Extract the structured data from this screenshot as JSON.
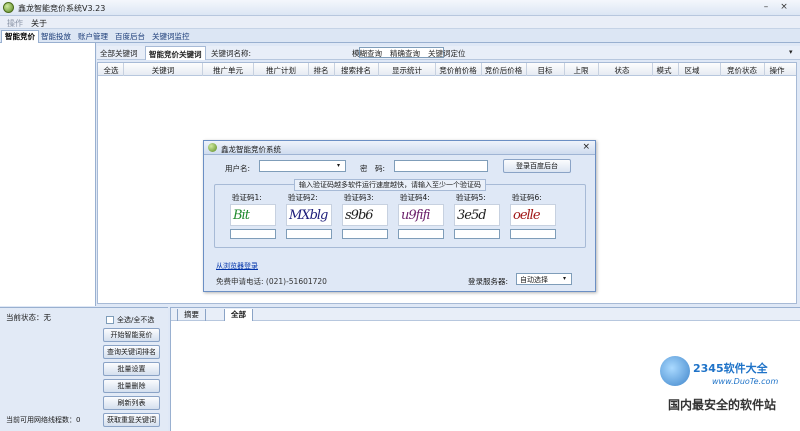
{
  "window": {
    "title": "鑫龙智能竞价系统V3.23",
    "min": "–",
    "close": "×"
  },
  "menu": [
    "操作",
    "关于"
  ],
  "main_tabs": [
    "智能竞价",
    "智能投放",
    "账户管理",
    "百度后台",
    "关键词监控"
  ],
  "sub_toolbar": {
    "tabs": [
      "全部关键词",
      "智能竞价关键词"
    ],
    "kw_label": "关键词名称:",
    "kw_value": "",
    "links": [
      "模糊查询",
      "精确查询",
      "关键词定位"
    ]
  },
  "grid_columns": [
    "全选",
    "关键词",
    "推广单元",
    "推广计划",
    "排名",
    "搜索排名",
    "显示统计",
    "竞价前价格",
    "竞价后价格",
    "目标",
    "上限",
    "状态",
    "模式",
    "区域",
    "竞价状态",
    "操作"
  ],
  "login_dialog": {
    "title": "鑫龙智能竞价系统",
    "close": "×",
    "username_label": "用户名:",
    "username_value": "",
    "password_label": "密　码:",
    "password_value": "",
    "login_button": "登录百度后台",
    "captcha_hint": "输入验证码越多软件运行速度越快，请输入至少一个验证码",
    "captchas": [
      {
        "label": "验证码1:",
        "text": "Bit",
        "color": "#1f8a2e"
      },
      {
        "label": "验证码2:",
        "text": "MXblg",
        "color": "#1c1c7a"
      },
      {
        "label": "验证码3:",
        "text": "s9b6",
        "color": "#222222"
      },
      {
        "label": "验证码4:",
        "text": "u9fifi",
        "color": "#6a1f6a"
      },
      {
        "label": "验证码5:",
        "text": "3e5d",
        "color": "#1a1a1a"
      },
      {
        "label": "验证码6:",
        "text": "oelle",
        "color": "#a01818"
      }
    ],
    "browser_login_link": "从浏览器登录",
    "phone_text": "免费申请电话: (021)-51601720",
    "server_label": "登录服务器:",
    "server_value": "自动选择"
  },
  "status_panel": {
    "current_status": "当前状态：无",
    "select_all": "全选/全不选",
    "buttons": [
      "开始智能竞价",
      "查询关键词排名",
      "批量设置",
      "批量删除",
      "刷新列表",
      "获取重复关键词"
    ],
    "available_threads": "当前可用网络线程数：0"
  },
  "log_tabs": [
    "摘要",
    "全部"
  ],
  "watermark": {
    "brand": "2345软件大全",
    "site": "www.DuoTe.com",
    "slogan": "国内最安全的软件站"
  }
}
